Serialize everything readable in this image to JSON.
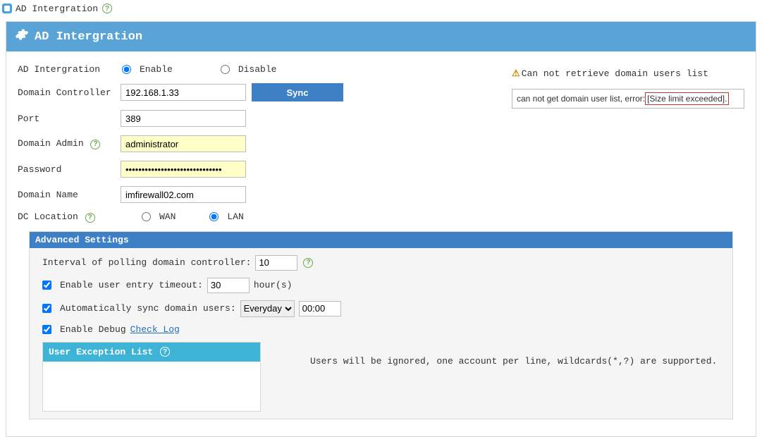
{
  "crumb_title": "AD Intergration",
  "panel_title": "AD Intergration",
  "labels": {
    "ad_int": "AD Intergration",
    "dc": "Domain Controller",
    "port": "Port",
    "admin": "Domain Admin",
    "pass": "Password",
    "dname": "Domain Name",
    "dcloc": "DC Location"
  },
  "radios": {
    "enable": "Enable",
    "disable": "Disable",
    "wan": "WAN",
    "lan": "LAN"
  },
  "fields": {
    "dc": "192.168.1.33",
    "port": "389",
    "admin": "administrator",
    "pass": "••••••••••••••••••••••••••••••",
    "dname": "imfirewall02.com"
  },
  "sync_btn": "Sync",
  "warning_title": "Can not retrieve domain users list",
  "error_prefix": "can not get domain user list, error:",
  "error_hi": "[Size limit exceeded].",
  "adv": {
    "title": "Advanced Settings",
    "interval_lbl": "Interval of polling domain controller:",
    "interval_val": "10",
    "timeout_lbl": "Enable user entry timeout:",
    "timeout_val": "30",
    "timeout_unit": "hour(s)",
    "sync_lbl": "Automatically sync domain users:",
    "sync_day": "Everyday",
    "sync_time": "00:00",
    "debug_lbl": "Enable Debug",
    "check_log": "Check Log",
    "excep_title": "User Exception List",
    "excep_note": "Users will be ignored, one account per line, wildcards(*,?) are supported."
  }
}
